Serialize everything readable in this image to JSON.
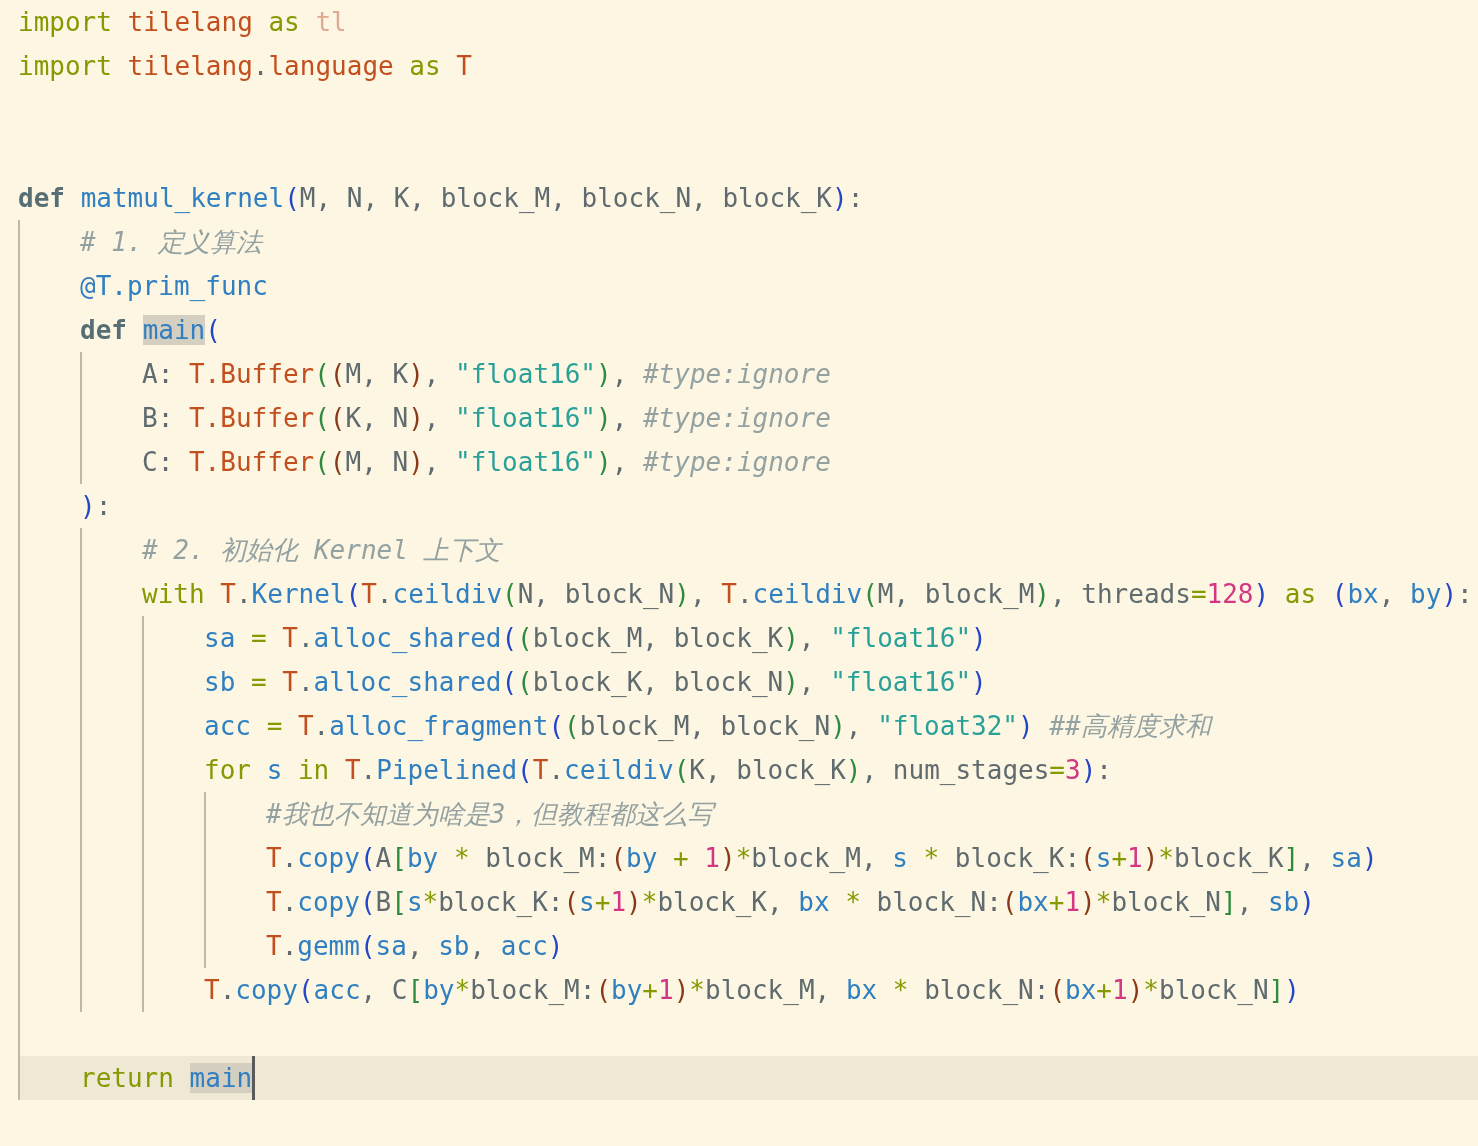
{
  "lines": [
    {
      "t": [
        {
          "s": "import ",
          "color": "#859900"
        },
        {
          "s": "tilelang ",
          "color": "#c2501f"
        },
        {
          "s": "as ",
          "color": "#859900"
        },
        {
          "s": "tl",
          "color": "#e0aa90"
        }
      ]
    },
    {
      "t": [
        {
          "s": "import ",
          "color": "#859900"
        },
        {
          "s": "tilelang",
          "color": "#c2501f"
        },
        {
          "s": ".",
          "color": "#5f6b6e"
        },
        {
          "s": "language ",
          "color": "#c2501f"
        },
        {
          "s": "as ",
          "color": "#859900"
        },
        {
          "s": "T",
          "color": "#c2501f"
        }
      ]
    },
    {
      "kind": "blank"
    },
    {
      "kind": "blank"
    },
    {
      "t": [
        {
          "s": "def ",
          "color": "#586e75",
          "bold": true
        },
        {
          "s": "matmul_kernel",
          "color": "#2f7fc1"
        },
        {
          "s": "(",
          "color": "#2446c8"
        },
        {
          "s": "M, N, K, block_M, block_N, block_K",
          "color": "#5f6b6e"
        },
        {
          "s": ")",
          "color": "#2446c8"
        },
        {
          "s": ":",
          "color": "#5f6b6e"
        }
      ],
      "children": [
        {
          "t": [
            {
              "s": "# 1. 定义算法",
              "color": "#93a1a1",
              "italic": true
            }
          ]
        },
        {
          "t": [
            {
              "s": "@T.prim_func",
              "color": "#2f7fc1"
            }
          ]
        },
        {
          "t": [
            {
              "s": "def ",
              "color": "#586e75",
              "bold": true
            },
            {
              "s": "main",
              "color": "#2f7fc1",
              "hl": true
            },
            {
              "s": "(",
              "color": "#2446c8"
            }
          ],
          "children": [
            {
              "t": [
                {
                  "s": "A: ",
                  "color": "#5f6b6e"
                },
                {
                  "s": "T.Buffer",
                  "color": "#c2501f"
                },
                {
                  "s": "(",
                  "color": "#2e8b3e"
                },
                {
                  "s": "(",
                  "color": "#8a3a1a"
                },
                {
                  "s": "M, K",
                  "color": "#5f6b6e"
                },
                {
                  "s": ")",
                  "color": "#8a3a1a"
                },
                {
                  "s": ", ",
                  "color": "#5f6b6e"
                },
                {
                  "s": "\"float16\"",
                  "color": "#2aa198"
                },
                {
                  "s": ")",
                  "color": "#2e8b3e"
                },
                {
                  "s": ", ",
                  "color": "#5f6b6e"
                },
                {
                  "s": "#type:ignore",
                  "color": "#93a1a1",
                  "italic": true
                }
              ]
            },
            {
              "t": [
                {
                  "s": "B: ",
                  "color": "#5f6b6e"
                },
                {
                  "s": "T.Buffer",
                  "color": "#c2501f"
                },
                {
                  "s": "(",
                  "color": "#2e8b3e"
                },
                {
                  "s": "(",
                  "color": "#8a3a1a"
                },
                {
                  "s": "K, N",
                  "color": "#5f6b6e"
                },
                {
                  "s": ")",
                  "color": "#8a3a1a"
                },
                {
                  "s": ", ",
                  "color": "#5f6b6e"
                },
                {
                  "s": "\"float16\"",
                  "color": "#2aa198"
                },
                {
                  "s": ")",
                  "color": "#2e8b3e"
                },
                {
                  "s": ", ",
                  "color": "#5f6b6e"
                },
                {
                  "s": "#type:ignore",
                  "color": "#93a1a1",
                  "italic": true
                }
              ]
            },
            {
              "t": [
                {
                  "s": "C: ",
                  "color": "#5f6b6e"
                },
                {
                  "s": "T.Buffer",
                  "color": "#c2501f"
                },
                {
                  "s": "(",
                  "color": "#2e8b3e"
                },
                {
                  "s": "(",
                  "color": "#8a3a1a"
                },
                {
                  "s": "M, N",
                  "color": "#5f6b6e"
                },
                {
                  "s": ")",
                  "color": "#8a3a1a"
                },
                {
                  "s": ", ",
                  "color": "#5f6b6e"
                },
                {
                  "s": "\"float16\"",
                  "color": "#2aa198"
                },
                {
                  "s": ")",
                  "color": "#2e8b3e"
                },
                {
                  "s": ", ",
                  "color": "#5f6b6e"
                },
                {
                  "s": "#type:ignore",
                  "color": "#93a1a1",
                  "italic": true
                }
              ]
            }
          ]
        },
        {
          "t": [
            {
              "s": ")",
              "color": "#2446c8"
            },
            {
              "s": ":",
              "color": "#5f6b6e"
            }
          ],
          "children": [
            {
              "t": [
                {
                  "s": "# 2. 初始化 Kernel 上下文",
                  "color": "#93a1a1",
                  "italic": true
                }
              ]
            },
            {
              "t": [
                {
                  "s": "with ",
                  "color": "#859900"
                },
                {
                  "s": "T",
                  "color": "#c2501f"
                },
                {
                  "s": ".",
                  "color": "#5f6b6e"
                },
                {
                  "s": "Kernel",
                  "color": "#2f7fc1"
                },
                {
                  "s": "(",
                  "color": "#2446c8"
                },
                {
                  "s": "T",
                  "color": "#c2501f"
                },
                {
                  "s": ".",
                  "color": "#5f6b6e"
                },
                {
                  "s": "ceildiv",
                  "color": "#2f7fc1"
                },
                {
                  "s": "(",
                  "color": "#2e8b3e"
                },
                {
                  "s": "N, block_N",
                  "color": "#5f6b6e"
                },
                {
                  "s": ")",
                  "color": "#2e8b3e"
                },
                {
                  "s": ", ",
                  "color": "#5f6b6e"
                },
                {
                  "s": "T",
                  "color": "#c2501f"
                },
                {
                  "s": ".",
                  "color": "#5f6b6e"
                },
                {
                  "s": "ceildiv",
                  "color": "#2f7fc1"
                },
                {
                  "s": "(",
                  "color": "#2e8b3e"
                },
                {
                  "s": "M, block_M",
                  "color": "#5f6b6e"
                },
                {
                  "s": ")",
                  "color": "#2e8b3e"
                },
                {
                  "s": ", threads",
                  "color": "#5f6b6e"
                },
                {
                  "s": "=",
                  "color": "#859900"
                },
                {
                  "s": "128",
                  "color": "#d33682"
                },
                {
                  "s": ")",
                  "color": "#2446c8"
                },
                {
                  "s": " as ",
                  "color": "#859900"
                },
                {
                  "s": "(",
                  "color": "#2446c8"
                },
                {
                  "s": "bx",
                  "color": "#2f7fc1"
                },
                {
                  "s": ", ",
                  "color": "#5f6b6e"
                },
                {
                  "s": "by",
                  "color": "#2f7fc1"
                },
                {
                  "s": ")",
                  "color": "#2446c8"
                },
                {
                  "s": ":",
                  "color": "#5f6b6e"
                }
              ],
              "children": [
                {
                  "t": [
                    {
                      "s": "sa ",
                      "color": "#2f7fc1"
                    },
                    {
                      "s": "= ",
                      "color": "#859900"
                    },
                    {
                      "s": "T",
                      "color": "#c2501f"
                    },
                    {
                      "s": ".",
                      "color": "#5f6b6e"
                    },
                    {
                      "s": "alloc_shared",
                      "color": "#2f7fc1"
                    },
                    {
                      "s": "(",
                      "color": "#2446c8"
                    },
                    {
                      "s": "(",
                      "color": "#2e8b3e"
                    },
                    {
                      "s": "block_M, block_K",
                      "color": "#5f6b6e"
                    },
                    {
                      "s": ")",
                      "color": "#2e8b3e"
                    },
                    {
                      "s": ", ",
                      "color": "#5f6b6e"
                    },
                    {
                      "s": "\"float16\"",
                      "color": "#2aa198"
                    },
                    {
                      "s": ")",
                      "color": "#2446c8"
                    }
                  ]
                },
                {
                  "t": [
                    {
                      "s": "sb ",
                      "color": "#2f7fc1"
                    },
                    {
                      "s": "= ",
                      "color": "#859900"
                    },
                    {
                      "s": "T",
                      "color": "#c2501f"
                    },
                    {
                      "s": ".",
                      "color": "#5f6b6e"
                    },
                    {
                      "s": "alloc_shared",
                      "color": "#2f7fc1"
                    },
                    {
                      "s": "(",
                      "color": "#2446c8"
                    },
                    {
                      "s": "(",
                      "color": "#2e8b3e"
                    },
                    {
                      "s": "block_K, block_N",
                      "color": "#5f6b6e"
                    },
                    {
                      "s": ")",
                      "color": "#2e8b3e"
                    },
                    {
                      "s": ", ",
                      "color": "#5f6b6e"
                    },
                    {
                      "s": "\"float16\"",
                      "color": "#2aa198"
                    },
                    {
                      "s": ")",
                      "color": "#2446c8"
                    }
                  ]
                },
                {
                  "t": [
                    {
                      "s": "acc ",
                      "color": "#2f7fc1"
                    },
                    {
                      "s": "= ",
                      "color": "#859900"
                    },
                    {
                      "s": "T",
                      "color": "#c2501f"
                    },
                    {
                      "s": ".",
                      "color": "#5f6b6e"
                    },
                    {
                      "s": "alloc_fragment",
                      "color": "#2f7fc1"
                    },
                    {
                      "s": "(",
                      "color": "#2446c8"
                    },
                    {
                      "s": "(",
                      "color": "#2e8b3e"
                    },
                    {
                      "s": "block_M, block_N",
                      "color": "#5f6b6e"
                    },
                    {
                      "s": ")",
                      "color": "#2e8b3e"
                    },
                    {
                      "s": ", ",
                      "color": "#5f6b6e"
                    },
                    {
                      "s": "\"float32\"",
                      "color": "#2aa198"
                    },
                    {
                      "s": ")",
                      "color": "#2446c8"
                    },
                    {
                      "s": " ##高精度求和",
                      "color": "#93a1a1",
                      "italic": true
                    }
                  ]
                },
                {
                  "t": [
                    {
                      "s": "for ",
                      "color": "#859900"
                    },
                    {
                      "s": "s ",
                      "color": "#2f7fc1"
                    },
                    {
                      "s": "in ",
                      "color": "#859900"
                    },
                    {
                      "s": "T",
                      "color": "#c2501f"
                    },
                    {
                      "s": ".",
                      "color": "#5f6b6e"
                    },
                    {
                      "s": "Pipelined",
                      "color": "#2f7fc1"
                    },
                    {
                      "s": "(",
                      "color": "#2446c8"
                    },
                    {
                      "s": "T",
                      "color": "#c2501f"
                    },
                    {
                      "s": ".",
                      "color": "#5f6b6e"
                    },
                    {
                      "s": "ceildiv",
                      "color": "#2f7fc1"
                    },
                    {
                      "s": "(",
                      "color": "#2e8b3e"
                    },
                    {
                      "s": "K, block_K",
                      "color": "#5f6b6e"
                    },
                    {
                      "s": ")",
                      "color": "#2e8b3e"
                    },
                    {
                      "s": ", num_stages",
                      "color": "#5f6b6e"
                    },
                    {
                      "s": "=",
                      "color": "#859900"
                    },
                    {
                      "s": "3",
                      "color": "#d33682"
                    },
                    {
                      "s": ")",
                      "color": "#2446c8"
                    },
                    {
                      "s": ":",
                      "color": "#5f6b6e"
                    }
                  ],
                  "children": [
                    {
                      "t": [
                        {
                          "s": "#我也不知道为啥是3，但教程都这么写",
                          "color": "#93a1a1",
                          "italic": true
                        }
                      ]
                    },
                    {
                      "t": [
                        {
                          "s": "T",
                          "color": "#c2501f"
                        },
                        {
                          "s": ".",
                          "color": "#5f6b6e"
                        },
                        {
                          "s": "copy",
                          "color": "#2f7fc1"
                        },
                        {
                          "s": "(",
                          "color": "#2446c8"
                        },
                        {
                          "s": "A",
                          "color": "#5f6b6e"
                        },
                        {
                          "s": "[",
                          "color": "#2e8b3e"
                        },
                        {
                          "s": "by ",
                          "color": "#2f7fc1"
                        },
                        {
                          "s": "* ",
                          "color": "#859900"
                        },
                        {
                          "s": "block_M:",
                          "color": "#5f6b6e"
                        },
                        {
                          "s": "(",
                          "color": "#8a3a1a"
                        },
                        {
                          "s": "by ",
                          "color": "#2f7fc1"
                        },
                        {
                          "s": "+ ",
                          "color": "#859900"
                        },
                        {
                          "s": "1",
                          "color": "#d33682"
                        },
                        {
                          "s": ")",
                          "color": "#8a3a1a"
                        },
                        {
                          "s": "*",
                          "color": "#859900"
                        },
                        {
                          "s": "block_M, ",
                          "color": "#5f6b6e"
                        },
                        {
                          "s": "s ",
                          "color": "#2f7fc1"
                        },
                        {
                          "s": "* ",
                          "color": "#859900"
                        },
                        {
                          "s": "block_K:",
                          "color": "#5f6b6e"
                        },
                        {
                          "s": "(",
                          "color": "#8a3a1a"
                        },
                        {
                          "s": "s",
                          "color": "#2f7fc1"
                        },
                        {
                          "s": "+",
                          "color": "#859900"
                        },
                        {
                          "s": "1",
                          "color": "#d33682"
                        },
                        {
                          "s": ")",
                          "color": "#8a3a1a"
                        },
                        {
                          "s": "*",
                          "color": "#859900"
                        },
                        {
                          "s": "block_K",
                          "color": "#5f6b6e"
                        },
                        {
                          "s": "]",
                          "color": "#2e8b3e"
                        },
                        {
                          "s": ", ",
                          "color": "#5f6b6e"
                        },
                        {
                          "s": "sa",
                          "color": "#2f7fc1"
                        },
                        {
                          "s": ")",
                          "color": "#2446c8"
                        }
                      ]
                    },
                    {
                      "t": [
                        {
                          "s": "T",
                          "color": "#c2501f"
                        },
                        {
                          "s": ".",
                          "color": "#5f6b6e"
                        },
                        {
                          "s": "copy",
                          "color": "#2f7fc1"
                        },
                        {
                          "s": "(",
                          "color": "#2446c8"
                        },
                        {
                          "s": "B",
                          "color": "#5f6b6e"
                        },
                        {
                          "s": "[",
                          "color": "#2e8b3e"
                        },
                        {
                          "s": "s",
                          "color": "#2f7fc1"
                        },
                        {
                          "s": "*",
                          "color": "#859900"
                        },
                        {
                          "s": "block_K:",
                          "color": "#5f6b6e"
                        },
                        {
                          "s": "(",
                          "color": "#8a3a1a"
                        },
                        {
                          "s": "s",
                          "color": "#2f7fc1"
                        },
                        {
                          "s": "+",
                          "color": "#859900"
                        },
                        {
                          "s": "1",
                          "color": "#d33682"
                        },
                        {
                          "s": ")",
                          "color": "#8a3a1a"
                        },
                        {
                          "s": "*",
                          "color": "#859900"
                        },
                        {
                          "s": "block_K, ",
                          "color": "#5f6b6e"
                        },
                        {
                          "s": "bx ",
                          "color": "#2f7fc1"
                        },
                        {
                          "s": "* ",
                          "color": "#859900"
                        },
                        {
                          "s": "block_N:",
                          "color": "#5f6b6e"
                        },
                        {
                          "s": "(",
                          "color": "#8a3a1a"
                        },
                        {
                          "s": "bx",
                          "color": "#2f7fc1"
                        },
                        {
                          "s": "+",
                          "color": "#859900"
                        },
                        {
                          "s": "1",
                          "color": "#d33682"
                        },
                        {
                          "s": ")",
                          "color": "#8a3a1a"
                        },
                        {
                          "s": "*",
                          "color": "#859900"
                        },
                        {
                          "s": "block_N",
                          "color": "#5f6b6e"
                        },
                        {
                          "s": "]",
                          "color": "#2e8b3e"
                        },
                        {
                          "s": ", ",
                          "color": "#5f6b6e"
                        },
                        {
                          "s": "sb",
                          "color": "#2f7fc1"
                        },
                        {
                          "s": ")",
                          "color": "#2446c8"
                        }
                      ]
                    },
                    {
                      "t": [
                        {
                          "s": "T",
                          "color": "#c2501f"
                        },
                        {
                          "s": ".",
                          "color": "#5f6b6e"
                        },
                        {
                          "s": "gemm",
                          "color": "#2f7fc1"
                        },
                        {
                          "s": "(",
                          "color": "#2446c8"
                        },
                        {
                          "s": "sa",
                          "color": "#2f7fc1"
                        },
                        {
                          "s": ", ",
                          "color": "#5f6b6e"
                        },
                        {
                          "s": "sb",
                          "color": "#2f7fc1"
                        },
                        {
                          "s": ", ",
                          "color": "#5f6b6e"
                        },
                        {
                          "s": "acc",
                          "color": "#2f7fc1"
                        },
                        {
                          "s": ")",
                          "color": "#2446c8"
                        }
                      ]
                    }
                  ]
                },
                {
                  "t": [
                    {
                      "s": "T",
                      "color": "#c2501f"
                    },
                    {
                      "s": ".",
                      "color": "#5f6b6e"
                    },
                    {
                      "s": "copy",
                      "color": "#2f7fc1"
                    },
                    {
                      "s": "(",
                      "color": "#2446c8"
                    },
                    {
                      "s": "acc",
                      "color": "#2f7fc1"
                    },
                    {
                      "s": ", C",
                      "color": "#5f6b6e"
                    },
                    {
                      "s": "[",
                      "color": "#2e8b3e"
                    },
                    {
                      "s": "by",
                      "color": "#2f7fc1"
                    },
                    {
                      "s": "*",
                      "color": "#859900"
                    },
                    {
                      "s": "block_M:",
                      "color": "#5f6b6e"
                    },
                    {
                      "s": "(",
                      "color": "#8a3a1a"
                    },
                    {
                      "s": "by",
                      "color": "#2f7fc1"
                    },
                    {
                      "s": "+",
                      "color": "#859900"
                    },
                    {
                      "s": "1",
                      "color": "#d33682"
                    },
                    {
                      "s": ")",
                      "color": "#8a3a1a"
                    },
                    {
                      "s": "*",
                      "color": "#859900"
                    },
                    {
                      "s": "block_M, ",
                      "color": "#5f6b6e"
                    },
                    {
                      "s": "bx ",
                      "color": "#2f7fc1"
                    },
                    {
                      "s": "* ",
                      "color": "#859900"
                    },
                    {
                      "s": "block_N:",
                      "color": "#5f6b6e"
                    },
                    {
                      "s": "(",
                      "color": "#8a3a1a"
                    },
                    {
                      "s": "bx",
                      "color": "#2f7fc1"
                    },
                    {
                      "s": "+",
                      "color": "#859900"
                    },
                    {
                      "s": "1",
                      "color": "#d33682"
                    },
                    {
                      "s": ")",
                      "color": "#8a3a1a"
                    },
                    {
                      "s": "*",
                      "color": "#859900"
                    },
                    {
                      "s": "block_N",
                      "color": "#5f6b6e"
                    },
                    {
                      "s": "]",
                      "color": "#2e8b3e"
                    },
                    {
                      "s": ")",
                      "color": "#2446c8"
                    }
                  ]
                }
              ]
            }
          ]
        },
        {
          "kind": "blank"
        },
        {
          "t": [
            {
              "s": "return ",
              "color": "#859900"
            },
            {
              "s": "main",
              "color": "#2f7fc1",
              "hl": true
            }
          ],
          "current": true,
          "cursor": true
        }
      ]
    }
  ]
}
